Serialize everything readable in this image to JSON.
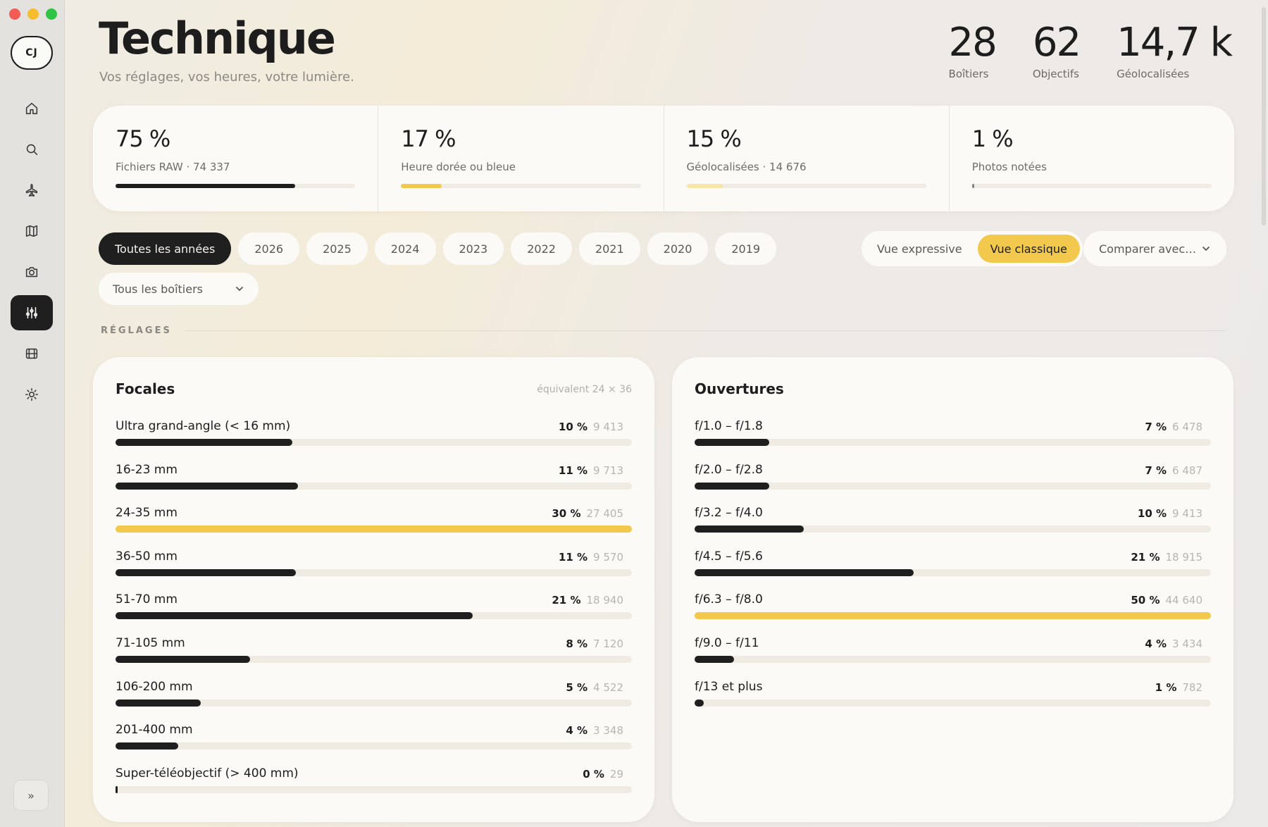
{
  "app": {
    "avatar_initials": "CJ",
    "expand_label": "»"
  },
  "nav": [
    {
      "icon": "home-icon",
      "active": false
    },
    {
      "icon": "search-icon",
      "active": false
    },
    {
      "icon": "airplane-icon",
      "active": false
    },
    {
      "icon": "map-icon",
      "active": false
    },
    {
      "icon": "camera-icon",
      "active": false
    },
    {
      "icon": "sliders-icon",
      "active": true
    },
    {
      "icon": "film-icon",
      "active": false
    },
    {
      "icon": "sun-icon",
      "active": false
    }
  ],
  "header": {
    "title": "Technique",
    "subtitle": "Vos réglages, vos heures, votre lumière.",
    "stats": [
      {
        "value": "28",
        "label": "Boîtiers"
      },
      {
        "value": "62",
        "label": "Objectifs"
      },
      {
        "value": "14,7 k",
        "label": "Géolocalisées"
      }
    ]
  },
  "kpis": [
    {
      "value": "75 %",
      "label": "Fichiers RAW · 74 337",
      "fraction": 0.75,
      "color": "#1f1f1f"
    },
    {
      "value": "17 %",
      "label": "Heure dorée ou bleue",
      "fraction": 0.17,
      "color": "#f2c94c"
    },
    {
      "value": "15 %",
      "label": "Géolocalisées · 14 676",
      "fraction": 0.15,
      "color": "#f7e6a6"
    },
    {
      "value": "1 %",
      "label": "Photos notées",
      "fraction": 0.01,
      "color": "#8a8782"
    }
  ],
  "filters": {
    "years": [
      "Toutes les années",
      "2026",
      "2025",
      "2024",
      "2023",
      "2022",
      "2021",
      "2020",
      "2019"
    ],
    "active_year": 0,
    "view_toggle": [
      "Vue expressive",
      "Vue classique"
    ],
    "active_view": 1,
    "compare_label": "Comparer avec…",
    "bodies_label": "Tous les boîtiers"
  },
  "section": {
    "title": "RÉGLAGES"
  },
  "focal": {
    "title": "Focales",
    "note": "équivalent 24 × 36",
    "rows": [
      {
        "label": "Ultra grand-angle (< 16 mm)",
        "pct": "10 %",
        "count": "9 413",
        "fraction": 0.343,
        "highlight": false
      },
      {
        "label": "16-23 mm",
        "pct": "11 %",
        "count": "9 713",
        "fraction": 0.354,
        "highlight": false
      },
      {
        "label": "24-35 mm",
        "pct": "30 %",
        "count": "27 405",
        "fraction": 1.0,
        "highlight": true
      },
      {
        "label": "36-50 mm",
        "pct": "11 %",
        "count": "9 570",
        "fraction": 0.349,
        "highlight": false
      },
      {
        "label": "51-70 mm",
        "pct": "21 %",
        "count": "18 940",
        "fraction": 0.691,
        "highlight": false
      },
      {
        "label": "71-105 mm",
        "pct": "8 %",
        "count": "7 120",
        "fraction": 0.26,
        "highlight": false
      },
      {
        "label": "106-200 mm",
        "pct": "5 %",
        "count": "4 522",
        "fraction": 0.165,
        "highlight": false
      },
      {
        "label": "201-400 mm",
        "pct": "4 %",
        "count": "3 348",
        "fraction": 0.122,
        "highlight": false
      },
      {
        "label": "Super-téléobjectif (> 400 mm)",
        "pct": "0 %",
        "count": "29",
        "fraction": 0.001,
        "highlight": false
      }
    ]
  },
  "aperture": {
    "title": "Ouvertures",
    "rows": [
      {
        "label": "f/1.0 – f/1.8",
        "pct": "7 %",
        "count": "6 478",
        "fraction": 0.145,
        "highlight": false
      },
      {
        "label": "f/2.0 – f/2.8",
        "pct": "7 %",
        "count": "6 487",
        "fraction": 0.145,
        "highlight": false
      },
      {
        "label": "f/3.2 – f/4.0",
        "pct": "10 %",
        "count": "9 413",
        "fraction": 0.211,
        "highlight": false
      },
      {
        "label": "f/4.5 – f/5.6",
        "pct": "21 %",
        "count": "18 915",
        "fraction": 0.424,
        "highlight": false
      },
      {
        "label": "f/6.3 – f/8.0",
        "pct": "50 %",
        "count": "44 640",
        "fraction": 1.0,
        "highlight": true
      },
      {
        "label": "f/9.0 – f/11",
        "pct": "4 %",
        "count": "3 434",
        "fraction": 0.077,
        "highlight": false
      },
      {
        "label": "f/13 et plus",
        "pct": "1 %",
        "count": "782",
        "fraction": 0.018,
        "highlight": false
      }
    ]
  }
}
